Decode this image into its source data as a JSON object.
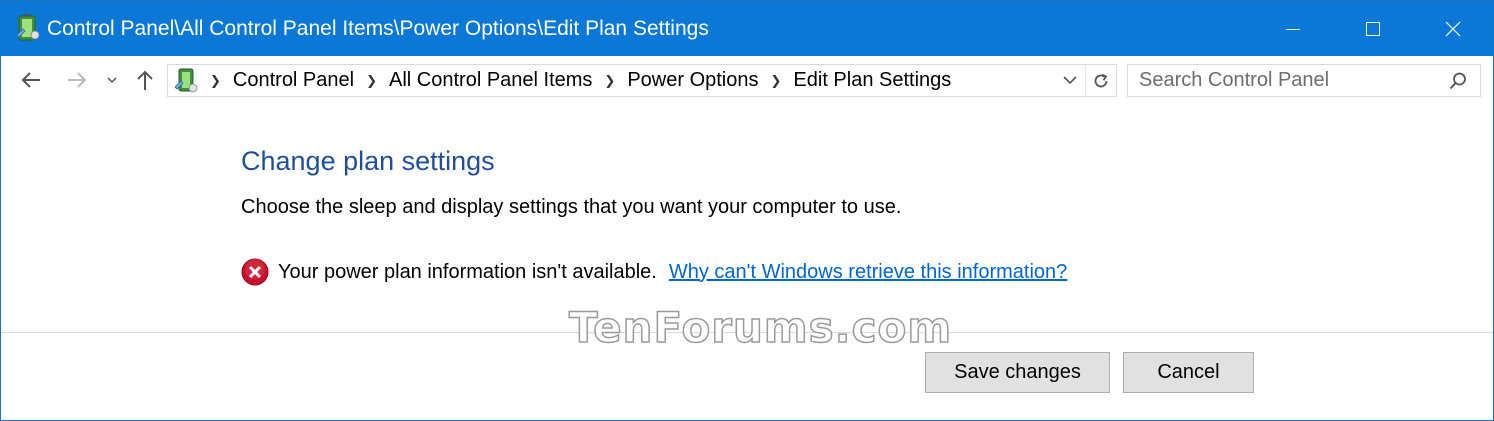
{
  "window": {
    "title": "Control Panel\\All Control Panel Items\\Power Options\\Edit Plan Settings",
    "accent_color": "#0b78d7"
  },
  "navigation": {
    "back_icon": "arrow-left-icon",
    "forward_icon": "arrow-right-icon",
    "recent_icon": "chevron-down-icon",
    "up_icon": "arrow-up-icon"
  },
  "address_bar": {
    "icon": "control-panel-icon",
    "breadcrumbs": [
      "Control Panel",
      "All Control Panel Items",
      "Power Options",
      "Edit Plan Settings"
    ]
  },
  "search": {
    "placeholder": "Search Control Panel",
    "value": ""
  },
  "content": {
    "heading": "Change plan settings",
    "description": "Choose the sleep and display settings that you want your computer to use.",
    "error_message": "Your power plan information isn't available.",
    "help_link": "Why can't Windows retrieve this information?",
    "heading_color": "#1e4e9c",
    "link_color": "#0066cc",
    "error_icon": "error-x-icon"
  },
  "watermark": "TenForums.com",
  "footer": {
    "save_label": "Save changes",
    "cancel_label": "Cancel"
  }
}
